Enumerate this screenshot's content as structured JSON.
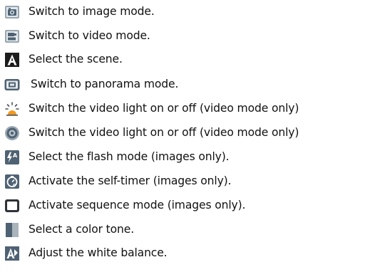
{
  "items": [
    {
      "icon": "image-mode-icon",
      "label": "Switch to image mode."
    },
    {
      "icon": "video-mode-icon",
      "label": "Switch to video mode."
    },
    {
      "icon": "scene-icon",
      "label": "Select the scene."
    },
    {
      "icon": "panorama-mode-icon",
      "label": "Switch to panorama mode."
    },
    {
      "icon": "video-light-icon",
      "label": "Switch the video light on or off (video mode only)"
    },
    {
      "icon": "video-light-off-icon",
      "label": "Switch the video light on or off (video mode only)"
    },
    {
      "icon": "flash-mode-icon",
      "label": "Select the flash mode (images only)."
    },
    {
      "icon": "self-timer-icon",
      "label": "Activate the self-timer (images only)."
    },
    {
      "icon": "sequence-mode-icon",
      "label": "Activate sequence mode (images only)."
    },
    {
      "icon": "color-tone-icon",
      "label": "Select a color tone."
    },
    {
      "icon": "white-balance-icon",
      "label": "Adjust the white balance."
    }
  ]
}
